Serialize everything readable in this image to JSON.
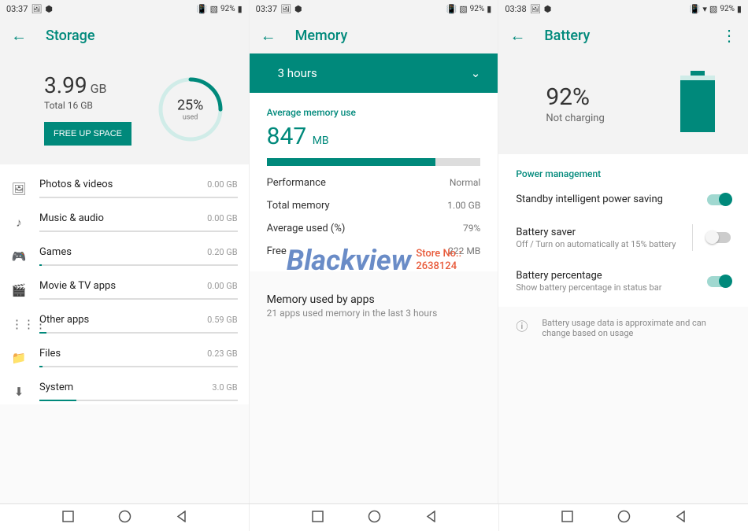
{
  "panels": {
    "storage": {
      "status": {
        "time": "03:37",
        "battery": "92%"
      },
      "title": "Storage",
      "used_value": "3.99",
      "used_unit": "GB",
      "total": "Total 16 GB",
      "free_btn": "FREE UP SPACE",
      "ring_pct": "25%",
      "ring_label": "used",
      "ring_fill": 25,
      "items": [
        {
          "icon": "🖼",
          "title": "Photos & videos",
          "size": "0.00 GB",
          "fill": 0
        },
        {
          "icon": "♪",
          "title": "Music & audio",
          "size": "0.00 GB",
          "fill": 0
        },
        {
          "icon": "🎮",
          "title": "Games",
          "size": "0.20 GB",
          "fill": 1.3
        },
        {
          "icon": "🎬",
          "title": "Movie & TV apps",
          "size": "0.00 GB",
          "fill": 0
        },
        {
          "icon": "⋮⋮⋮",
          "title": "Other apps",
          "size": "0.59 GB",
          "fill": 3.7
        },
        {
          "icon": "📁",
          "title": "Files",
          "size": "0.23 GB",
          "fill": 1.4
        },
        {
          "icon": "⬇",
          "title": "System",
          "size": "3.0 GB",
          "fill": 18.8
        }
      ]
    },
    "memory": {
      "status": {
        "time": "03:37",
        "battery": "92%"
      },
      "title": "Memory",
      "dropdown": "3 hours",
      "avg_label": "Average memory use",
      "avg_value": "847",
      "avg_unit": "MB",
      "bar_fill": 79,
      "rows": [
        {
          "label": "Performance",
          "value": "Normal"
        },
        {
          "label": "Total memory",
          "value": "1.00 GB"
        },
        {
          "label": "Average used (%)",
          "value": "79%"
        },
        {
          "label": "Free",
          "value": "222 MB"
        }
      ],
      "apps_title": "Memory used by apps",
      "apps_sub": "21 apps used memory in the last 3 hours"
    },
    "battery": {
      "status": {
        "time": "03:38",
        "battery": "92%"
      },
      "title": "Battery",
      "pct": "92%",
      "pct_num": 92,
      "charging": "Not charging",
      "section": "Power management",
      "rows": [
        {
          "title": "Standby intelligent power saving",
          "sub": "",
          "on": true,
          "divider": false
        },
        {
          "title": "Battery saver",
          "sub": "Off / Turn on automatically at 15% battery",
          "on": false,
          "divider": true
        },
        {
          "title": "Battery percentage",
          "sub": "Show battery percentage in status bar",
          "on": true,
          "divider": false
        }
      ],
      "info": "Battery usage data is approximate and can change based on usage"
    }
  },
  "watermark": {
    "brand": "Blackview",
    "store_label": "Store No.:",
    "store_no": "2638124"
  }
}
